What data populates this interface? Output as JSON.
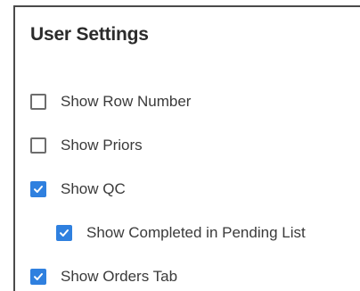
{
  "settings": {
    "title": "User Settings",
    "options": [
      {
        "label": "Show Row Number",
        "checked": false
      },
      {
        "label": "Show Priors",
        "checked": false
      },
      {
        "label": "Show QC",
        "checked": true
      },
      {
        "label": "Show Completed in Pending List",
        "checked": true
      },
      {
        "label": "Show Orders Tab",
        "checked": true
      }
    ]
  },
  "colors": {
    "checkbox_checked": "#2f80df",
    "checkbox_unchecked_border": "#6d6d6d",
    "panel_border": "#4a4a4a"
  }
}
